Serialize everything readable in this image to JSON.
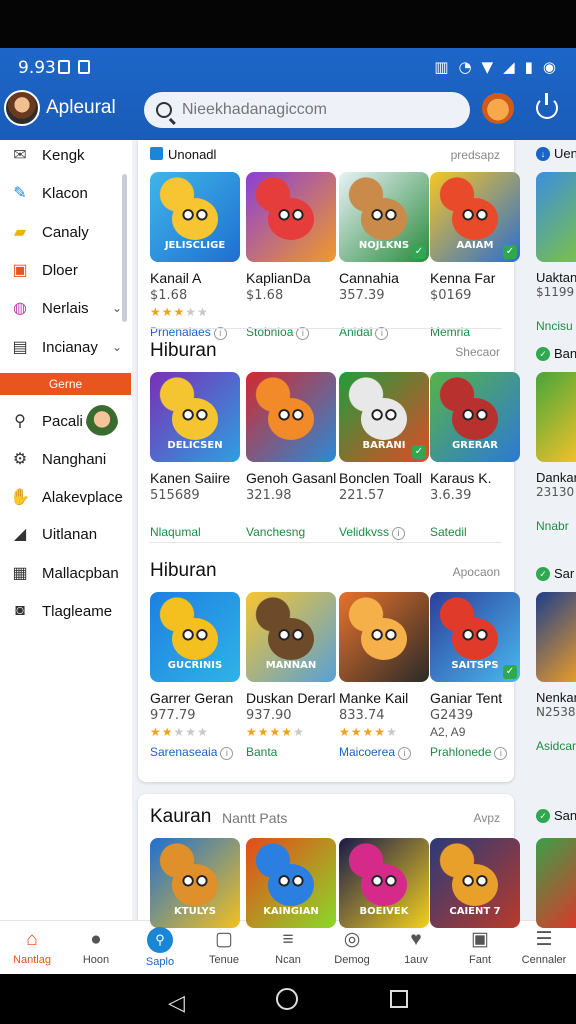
{
  "status": {
    "time": "9.93"
  },
  "header": {
    "brand": "Apleural",
    "search_placeholder": "Nieekhadanagiccom"
  },
  "sidebar": {
    "items": [
      {
        "label": "Kengk",
        "icon": "mail-icon",
        "glyph": "✉"
      },
      {
        "label": "Klacon",
        "icon": "brush-icon",
        "glyph": "✎"
      },
      {
        "label": "Canaly",
        "icon": "folder-icon",
        "glyph": "▰"
      },
      {
        "label": "Dloer",
        "icon": "image-icon",
        "glyph": "▣"
      },
      {
        "label": "Nerlais",
        "icon": "palette-icon",
        "glyph": "◍",
        "chevron": true
      },
      {
        "label": "Incianay",
        "icon": "device-icon",
        "glyph": "▤",
        "chevron": true
      }
    ],
    "section": "Gerne",
    "items2": [
      {
        "label": "Pacali",
        "icon": "search-icon",
        "glyph": "⚲"
      },
      {
        "label": "Nanghani",
        "icon": "gear-icon",
        "glyph": "⚙"
      },
      {
        "label": "Alakevplace",
        "icon": "handshake-icon",
        "glyph": "✋"
      },
      {
        "label": "Uitlanan",
        "icon": "chart-icon",
        "glyph": "◢"
      },
      {
        "label": "Mallacpban",
        "icon": "calendar-icon",
        "glyph": "▦"
      },
      {
        "label": "Tlagleame",
        "icon": "badge-icon",
        "glyph": "◙"
      }
    ]
  },
  "sections": [
    {
      "title": "Unonadl",
      "more": "predsapz",
      "cards": [
        {
          "title": "Kanail A",
          "price": "$1.68",
          "rating": 3,
          "category": "Prnenalaes",
          "cat_color": "blue",
          "info": true,
          "logo": "JELISCLIGE"
        },
        {
          "title": "KaplianDa",
          "price": "$1.68",
          "rating": 0,
          "category": "Stobnioa",
          "info": true,
          "logo": ""
        },
        {
          "title": "Cannahia",
          "price": "357.39",
          "rating": 0,
          "category": "Anidal",
          "info": true,
          "logo": "NOJLKNS"
        },
        {
          "title": "Kenna Far",
          "price": "$0169",
          "rating": 0,
          "category": "Memria",
          "info": false,
          "logo": "AAIAM"
        }
      ]
    },
    {
      "title": "Hiburan",
      "more": "Shecaor",
      "cards": [
        {
          "title": "Kanen Saiire",
          "price": "515689",
          "rating": 0,
          "category": "Nlaqumal",
          "info": false,
          "logo": "DELICSEN"
        },
        {
          "title": "Genoh Gasanl",
          "price": "321.98",
          "rating": 0,
          "category": "Vanchesng",
          "info": false,
          "logo": ""
        },
        {
          "title": "Bonclen Toall",
          "price": "221.57",
          "rating": 0,
          "category": "Velidkvss",
          "info": true,
          "logo": "BARANI"
        },
        {
          "title": "Karaus K.",
          "price": "3.6.39",
          "rating": 0,
          "category": "Satedil",
          "info": false,
          "logo": "GRERAR"
        }
      ]
    },
    {
      "title": "Hiburan",
      "more": "Apocaon",
      "cards": [
        {
          "title": "Garrer Geran",
          "price": "977.79",
          "rating": 2,
          "category": "Sarenaseaia",
          "cat_color": "blue",
          "info": true,
          "logo": "GUCRINIS"
        },
        {
          "title": "Duskan Derarl",
          "price": "937.90",
          "rating": 4,
          "category": "Banta",
          "info": false,
          "logo": "MANNAN"
        },
        {
          "title": "Manke Kail",
          "price": "833.74",
          "rating": 4,
          "category": "Maicoerea",
          "cat_color": "blue",
          "info": true,
          "logo": ""
        },
        {
          "title": "Ganiar Tent",
          "price": "G2439",
          "sub": "A2, A9",
          "rating": 0,
          "category": "Prahlonede",
          "info": true,
          "logo": "SAITSPS"
        }
      ]
    },
    {
      "title": "Kauran",
      "subtitle": "Nantt Pats",
      "more": "Avpz",
      "cards": [
        {
          "logo": "KTULYS"
        },
        {
          "logo": "KAINGIAN"
        },
        {
          "logo": "BOEIVEK"
        },
        {
          "logo": "CAIENT 7"
        }
      ]
    }
  ],
  "right_column": [
    {
      "head": "Uen",
      "title": "Uaktan",
      "price": "$1199",
      "category": "Nncisu"
    },
    {
      "head": "Ban",
      "title": "Dankar",
      "price": "23130",
      "category": "Nnabr"
    },
    {
      "head": "Sar",
      "title": "Nenkar",
      "price": "N2538",
      "category": "Asidcar"
    },
    {
      "head": "San"
    }
  ],
  "bottom_nav": [
    {
      "label": "Nantlag",
      "icon": "home-icon",
      "glyph": "⌂",
      "active": true
    },
    {
      "label": "Hoon",
      "icon": "person-icon",
      "glyph": "●"
    },
    {
      "label": "Saplo",
      "icon": "search-circle-icon",
      "glyph": "⚲",
      "blue": true
    },
    {
      "label": "Tenue",
      "icon": "chat-icon",
      "glyph": "▢"
    },
    {
      "label": "Ncan",
      "icon": "bolt-icon",
      "glyph": "≡"
    },
    {
      "label": "Demog",
      "icon": "compass-icon",
      "glyph": "◎"
    },
    {
      "label": "1auv",
      "icon": "heart-icon",
      "glyph": "♥"
    },
    {
      "label": "Fant",
      "icon": "tv-icon",
      "glyph": "▣"
    },
    {
      "label": "Cennaler",
      "icon": "menu-icon",
      "glyph": "☰"
    }
  ],
  "colors": {
    "appbar": "#1d66c9",
    "accent": "#e9551f",
    "green": "#1f8a45",
    "blue": "#1b63c4"
  }
}
